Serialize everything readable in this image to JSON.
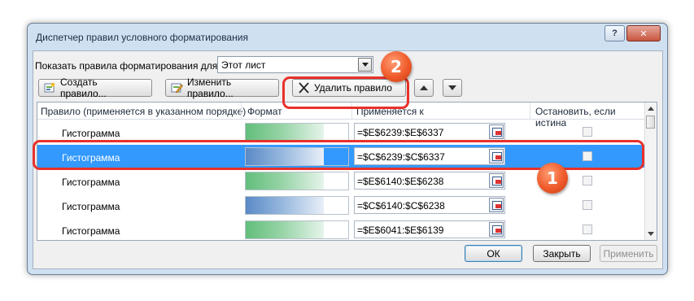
{
  "window": {
    "title": "Диспетчер правил условного форматирования",
    "help_icon": "?",
    "close_icon": "✕"
  },
  "show_rules": {
    "label": "Показать правила форматирования для:",
    "selected": "Этот лист"
  },
  "toolbar": {
    "create_label": "Создать правило...",
    "edit_label": "Изменить правило...",
    "delete_label": "Удалить правило"
  },
  "columns": {
    "rule": "Правило (применяется в указанном порядке)",
    "format": "Формат",
    "applies": "Применяется к",
    "stop": "Остановить, если истина"
  },
  "rules": [
    {
      "name": "Гистограмма",
      "applies": "=$E$6239:$E$6337",
      "color": "green",
      "stop": false
    },
    {
      "name": "Гистограмма",
      "applies": "=$C$6239:$C$6337",
      "color": "blue",
      "stop": false,
      "selected": true
    },
    {
      "name": "Гистограмма",
      "applies": "=$E$6140:$E$6238",
      "color": "green",
      "stop": false
    },
    {
      "name": "Гистограмма",
      "applies": "=$C$6140:$C$6238",
      "color": "blue",
      "stop": false
    },
    {
      "name": "Гистограмма",
      "applies": "=$E$6041:$E$6139",
      "color": "green",
      "stop": false
    }
  ],
  "footer": {
    "ok": "ОК",
    "close": "Закрыть",
    "apply": "Применить"
  },
  "annotations": {
    "step1": "1",
    "step2": "2",
    "color": "#e8312a"
  }
}
